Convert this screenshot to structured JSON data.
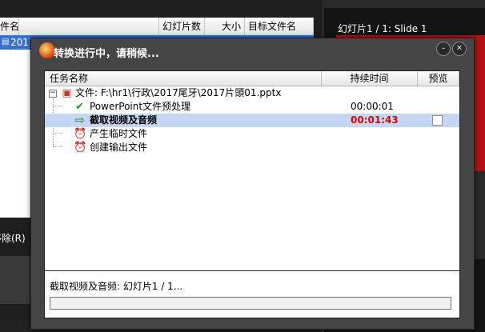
{
  "background": {
    "table_headers": [
      "文件名",
      "幻灯片数",
      "大小",
      "目标文件名"
    ],
    "first_row_name": "2017",
    "slide_title": "幻灯片1 / 1: Slide 1",
    "remove_label": "移除(R)"
  },
  "dialog": {
    "title": "转换进行中，请稍候...",
    "columns": {
      "name": "任务名称",
      "duration": "持续时间",
      "preview": "预览"
    },
    "file_label": "文件: F:\\hr1\\行政\\2017尾牙\\2017片頭01.pptx",
    "tasks": [
      {
        "label": "PowerPoint文件预处理",
        "duration": "00:00:01",
        "state": "done"
      },
      {
        "label": "截取视频及音频",
        "duration": "00:01:43",
        "state": "running"
      },
      {
        "label": "产生临时文件",
        "duration": "",
        "state": "pending"
      },
      {
        "label": "创建输出文件",
        "duration": "",
        "state": "pending"
      }
    ],
    "status_text": "截取视频及音频: 幻灯片1 / 1...",
    "progress": 0
  },
  "colors": {
    "running_duration": "#e00000",
    "selected_row": "#c5d6f3",
    "done_check": "#1aa01a",
    "arrow": "#2f9e2f"
  }
}
